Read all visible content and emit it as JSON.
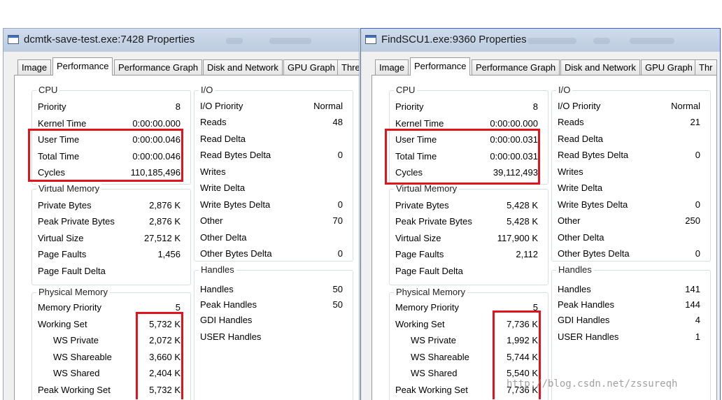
{
  "left": {
    "title": "dcmtk-save-test.exe:7428 Properties",
    "tabs": [
      "Image",
      "Performance",
      "Performance Graph",
      "Disk and Network",
      "GPU Graph",
      "Thre"
    ],
    "cpu": {
      "title": "CPU",
      "priority": {
        "label": "Priority",
        "value": "8"
      },
      "kernel": {
        "label": "Kernel Time",
        "value": "0:00:00.000"
      },
      "user": {
        "label": "User Time",
        "value": "0:00:00.046"
      },
      "total": {
        "label": "Total Time",
        "value": "0:00:00.046"
      },
      "cycles": {
        "label": "Cycles",
        "value": "110,185,496"
      }
    },
    "vm": {
      "title": "Virtual Memory",
      "private": {
        "label": "Private Bytes",
        "value": "2,876 K"
      },
      "peak_private": {
        "label": "Peak Private Bytes",
        "value": "2,876 K"
      },
      "virtual": {
        "label": "Virtual Size",
        "value": "27,512 K"
      },
      "faults": {
        "label": "Page Faults",
        "value": "1,456"
      },
      "fault_delta": {
        "label": "Page Fault Delta",
        "value": ""
      }
    },
    "pm": {
      "title": "Physical Memory",
      "priority": {
        "label": "Memory Priority",
        "value": "5"
      },
      "ws": {
        "label": "Working Set",
        "value": "5,732 K"
      },
      "ws_private": {
        "label": "WS Private",
        "value": "2,072 K"
      },
      "ws_shareable": {
        "label": "WS Shareable",
        "value": "3,660 K"
      },
      "ws_shared": {
        "label": "WS Shared",
        "value": "2,404 K"
      },
      "peak_ws": {
        "label": "Peak Working Set",
        "value": "5,732 K"
      }
    },
    "io": {
      "title": "I/O",
      "priority": {
        "label": "I/O Priority",
        "value": "Normal"
      },
      "reads": {
        "label": "Reads",
        "value": "48"
      },
      "read_delta": {
        "label": "Read Delta",
        "value": ""
      },
      "read_bytes_delta": {
        "label": "Read Bytes Delta",
        "value": "0"
      },
      "writes": {
        "label": "Writes",
        "value": ""
      },
      "write_delta": {
        "label": "Write Delta",
        "value": ""
      },
      "write_bytes_delta": {
        "label": "Write Bytes Delta",
        "value": "0"
      },
      "other": {
        "label": "Other",
        "value": "70"
      },
      "other_delta": {
        "label": "Other Delta",
        "value": ""
      },
      "other_bytes_delta": {
        "label": "Other Bytes Delta",
        "value": "0"
      }
    },
    "handles": {
      "title": "Handles",
      "handles": {
        "label": "Handles",
        "value": "50"
      },
      "peak": {
        "label": "Peak Handles",
        "value": "50"
      },
      "gdi": {
        "label": "GDI Handles",
        "value": ""
      },
      "user": {
        "label": "USER Handles",
        "value": ""
      }
    }
  },
  "right": {
    "title": "FindSCU1.exe:9360 Properties",
    "tabs": [
      "Image",
      "Performance",
      "Performance Graph",
      "Disk and Network",
      "GPU Graph",
      "Thr"
    ],
    "cpu": {
      "title": "CPU",
      "priority": {
        "label": "Priority",
        "value": "8"
      },
      "kernel": {
        "label": "Kernel Time",
        "value": "0:00:00.000"
      },
      "user": {
        "label": "User Time",
        "value": "0:00:00.031"
      },
      "total": {
        "label": "Total Time",
        "value": "0:00:00.031"
      },
      "cycles": {
        "label": "Cycles",
        "value": "39,112,493"
      }
    },
    "vm": {
      "title": "Virtual Memory",
      "private": {
        "label": "Private Bytes",
        "value": "5,428 K"
      },
      "peak_private": {
        "label": "Peak Private Bytes",
        "value": "5,428 K"
      },
      "virtual": {
        "label": "Virtual Size",
        "value": "117,900 K"
      },
      "faults": {
        "label": "Page Faults",
        "value": "2,112"
      },
      "fault_delta": {
        "label": "Page Fault Delta",
        "value": ""
      }
    },
    "pm": {
      "title": "Physical Memory",
      "priority": {
        "label": "Memory Priority",
        "value": "5"
      },
      "ws": {
        "label": "Working Set",
        "value": "7,736 K"
      },
      "ws_private": {
        "label": "WS Private",
        "value": "1,992 K"
      },
      "ws_shareable": {
        "label": "WS Shareable",
        "value": "5,744 K"
      },
      "ws_shared": {
        "label": "WS Shared",
        "value": "5,540 K"
      },
      "peak_ws": {
        "label": "Peak Working Set",
        "value": "7,736 K"
      }
    },
    "io": {
      "title": "I/O",
      "priority": {
        "label": "I/O Priority",
        "value": "Normal"
      },
      "reads": {
        "label": "Reads",
        "value": "21"
      },
      "read_delta": {
        "label": "Read Delta",
        "value": ""
      },
      "read_bytes_delta": {
        "label": "Read Bytes Delta",
        "value": "0"
      },
      "writes": {
        "label": "Writes",
        "value": ""
      },
      "write_delta": {
        "label": "Write Delta",
        "value": ""
      },
      "write_bytes_delta": {
        "label": "Write Bytes Delta",
        "value": "0"
      },
      "other": {
        "label": "Other",
        "value": "250"
      },
      "other_delta": {
        "label": "Other Delta",
        "value": ""
      },
      "other_bytes_delta": {
        "label": "Other Bytes Delta",
        "value": "0"
      }
    },
    "handles": {
      "title": "Handles",
      "handles": {
        "label": "Handles",
        "value": "141"
      },
      "peak": {
        "label": "Peak Handles",
        "value": "144"
      },
      "gdi": {
        "label": "GDI Handles",
        "value": "4"
      },
      "user": {
        "label": "USER Handles",
        "value": "1"
      }
    }
  },
  "watermark": "http://blog.csdn.net/zssureqh",
  "colors": {
    "highlight": "#e0141c",
    "title_bar": "#c6d4e7",
    "active_border": "#3d5fd6"
  }
}
